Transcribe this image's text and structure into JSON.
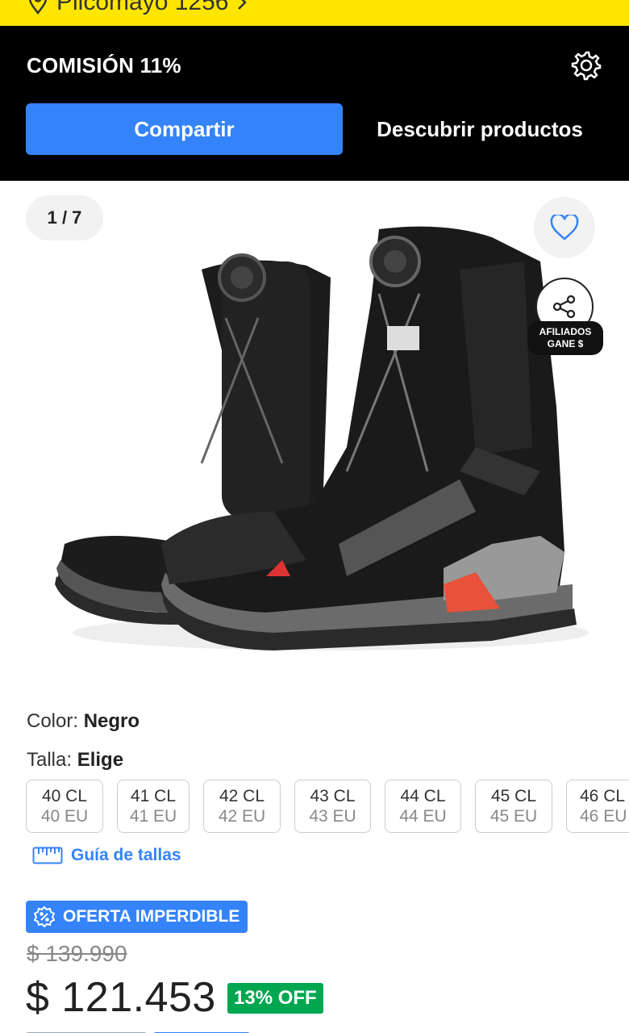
{
  "top_bar": {
    "location_text": "Pilcomayo 1256"
  },
  "affiliate_bar": {
    "commission_label": "COMISIÓN 11%",
    "share_button": "Compartir",
    "discover_button": "Descubrir productos"
  },
  "gallery": {
    "counter": "1 / 7",
    "affiliate_label_line1": "AFILIADOS",
    "affiliate_label_line2": "GANE $"
  },
  "variants": {
    "color_label": "Color: ",
    "color_value": "Negro",
    "size_label": "Talla: ",
    "size_value": "Elige",
    "sizes": [
      {
        "cl": "40 CL",
        "eu": "40 EU"
      },
      {
        "cl": "41 CL",
        "eu": "41 EU"
      },
      {
        "cl": "42 CL",
        "eu": "42 EU"
      },
      {
        "cl": "43 CL",
        "eu": "43 EU"
      },
      {
        "cl": "44 CL",
        "eu": "44 EU"
      },
      {
        "cl": "45 CL",
        "eu": "45 EU"
      },
      {
        "cl": "46 CL",
        "eu": "46 EU"
      }
    ],
    "size_guide": "Guía de tallas"
  },
  "pricing": {
    "offer_badge": "OFERTA IMPERDIBLE",
    "original_price": "$ 139.990",
    "price": "$ 121.453",
    "discount": "13% OFF"
  },
  "colors": {
    "brand_yellow": "#FFE600",
    "accent_blue": "#3483FA",
    "discount_green": "#00A650"
  }
}
